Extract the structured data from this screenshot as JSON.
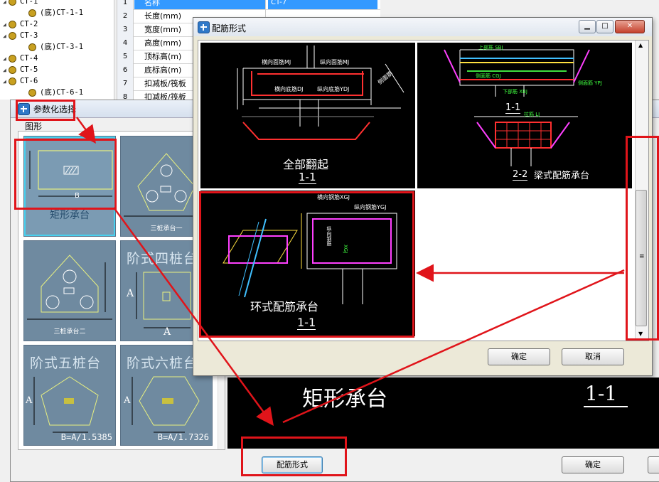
{
  "tree": [
    {
      "label": "CT-1",
      "indent": 0
    },
    {
      "label": "(底)CT-1-1",
      "indent": 1
    },
    {
      "label": "CT-2",
      "indent": 0
    },
    {
      "label": "CT-3",
      "indent": 0
    },
    {
      "label": "(底)CT-3-1",
      "indent": 1
    },
    {
      "label": "CT-4",
      "indent": 0
    },
    {
      "label": "CT-5",
      "indent": 0
    },
    {
      "label": "CT-6",
      "indent": 0
    },
    {
      "label": "(底)CT-6-1",
      "indent": 1
    }
  ],
  "props": [
    {
      "num": "1",
      "name": "名称",
      "value": "CT-7"
    },
    {
      "num": "2",
      "name": "长度(mm)",
      "value": ""
    },
    {
      "num": "3",
      "name": "宽度(mm)",
      "value": ""
    },
    {
      "num": "4",
      "name": "高度(mm)",
      "value": ""
    },
    {
      "num": "5",
      "name": "顶标高(m)",
      "value": ""
    },
    {
      "num": "6",
      "name": "底标高(m)",
      "value": ""
    },
    {
      "num": "7",
      "name": "扣减板/筏板",
      "value": ""
    },
    {
      "num": "8",
      "name": "扣减板/筏板",
      "value": ""
    }
  ],
  "param_dialog": {
    "title": "参数化选择",
    "section_label": "图形",
    "shapes": [
      {
        "name": "矩形承台",
        "big": "",
        "formula": ""
      },
      {
        "name": "三桩承台一",
        "big": "",
        "formula": ""
      },
      {
        "name": "三桩承台二",
        "big": "",
        "formula": ""
      },
      {
        "name": "",
        "big": "阶式四桩台",
        "formula": ""
      },
      {
        "name": "",
        "big": "阶式五桩台",
        "formula": "B=A/1.5385"
      },
      {
        "name": "",
        "big": "阶式六桩台",
        "formula": "B=A/1.7326"
      }
    ],
    "preview_title": "矩形承台",
    "preview_section": "1-1",
    "reinforce_button": "配筋形式",
    "ok_button": "确定"
  },
  "rebar_dialog": {
    "title": "配筋形式",
    "options": [
      {
        "name": "全部翻起",
        "section": "1-1",
        "labels": [
          "横向面筋MJ",
          "纵向面筋MJ",
          "横向底筋DJ",
          "纵向底筋YDJ",
          "侧面筋"
        ]
      },
      {
        "name": "梁式配筋承台",
        "section": "2-2",
        "section_top": "1-1",
        "labels": [
          "上部筋 SBJ",
          "侧面筋 CGJ",
          "下部筋 XBJ",
          "拉筋 LJ",
          "侧面筋 YPJ"
        ]
      },
      {
        "name": "环式配筋承台",
        "section": "1-1",
        "labels": [
          "横向钢筋XGJ",
          "纵向钢筋YGJ",
          "纵向钢筋",
          "XGJ"
        ]
      }
    ],
    "ok_button": "确定",
    "cancel_button": "取消"
  },
  "colors": {
    "annotation": "#e0141a",
    "accent": "#3399ff",
    "thumb_bg": "#6f8aa0"
  }
}
